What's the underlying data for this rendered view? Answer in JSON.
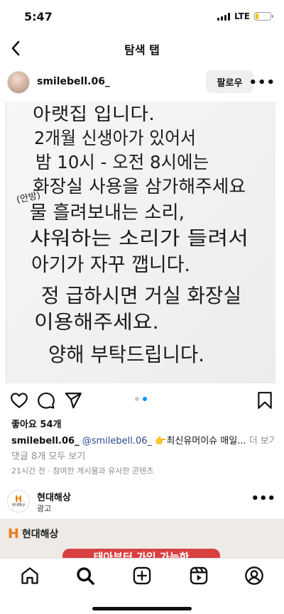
{
  "status_bar": {
    "time": "5:47",
    "network": "LTE",
    "battery_level": 0.2
  },
  "header": {
    "title": "탐색 탭",
    "back_icon": "chevron-left-icon"
  },
  "post": {
    "username": "smilebell.06_",
    "follow_label": "팔로우",
    "more_label": "•••",
    "image_text_lines": [
      "아랫집 입니다.",
      "2개월 신생아가 있어서",
      "밤 10시 - 오전 8시에는",
      "화장실 사용을 삼가해주세요",
      "물 흘려보내는 소리,",
      "샤워하는 소리가 들려서",
      "아기가 자꾸 깹니다.",
      "정 급하시면 거실 화장실",
      "이용해주세요.",
      "양해 부탁드립니다."
    ],
    "image_annotation": "(안방)",
    "carousel": {
      "count": 2,
      "active": 2
    },
    "likes": "좋아요 54개",
    "caption": {
      "user": "smilebell.06_",
      "mention": "@smilebell.06_",
      "emoji": "👉",
      "text": "최신유머이슈 매일...",
      "more": "더 보기"
    },
    "comments_link": "댓글 8개 모두 보기",
    "meta": "21시간 전 · 참여한 게시물과 유사한 콘텐츠"
  },
  "ad": {
    "name": "현대해상",
    "label": "광고",
    "avatar_letter": "H",
    "avatar_text": "현대해상",
    "banner_logo_letter": "H",
    "banner_logo_text": "현대해상",
    "banner_text": "태아부터 가입 가능한"
  },
  "colors": {
    "accent_blue": "#0095f6",
    "ad_orange": "#f07b13",
    "ad_red": "#d94040",
    "handwriting": "#1c1c1c"
  },
  "tab_bar": {
    "icons": [
      "home-icon",
      "search-icon",
      "create-icon",
      "reels-icon",
      "profile-icon"
    ],
    "active": "search-icon"
  }
}
